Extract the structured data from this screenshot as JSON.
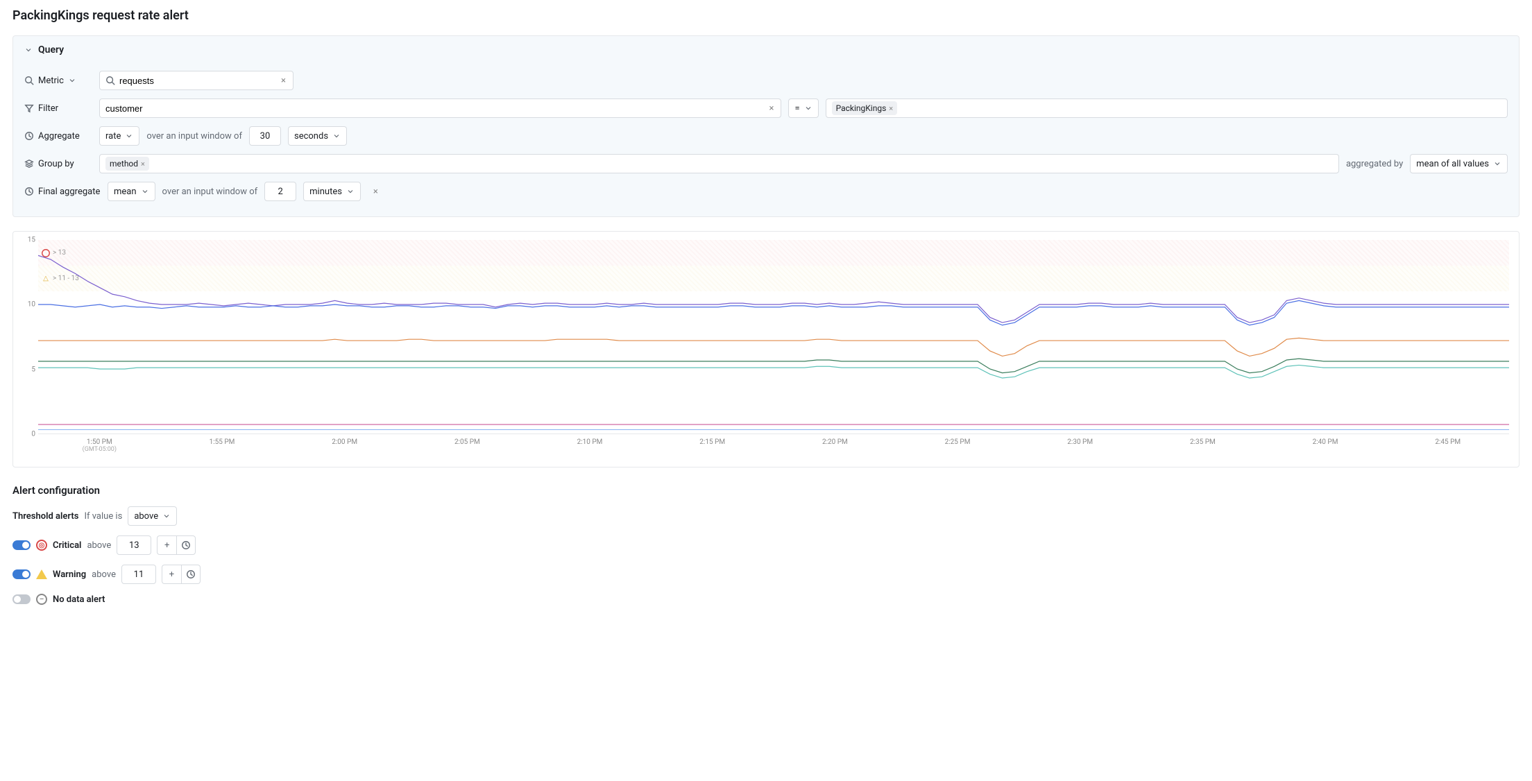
{
  "page_title": "PackingKings request rate alert",
  "query_panel": {
    "header": "Query",
    "rows": {
      "metric": {
        "label": "Metric",
        "value": "requests"
      },
      "filter": {
        "label": "Filter",
        "value": "customer",
        "operator": "=",
        "tag": "PackingKings"
      },
      "aggregate": {
        "label": "Aggregate",
        "fn": "rate",
        "window_text": "over an input window of",
        "window_value": "30",
        "window_unit": "seconds"
      },
      "groupby": {
        "label": "Group by",
        "tag": "method",
        "agg_by_text": "aggregated by",
        "agg_by_value": "mean of all values"
      },
      "final_aggregate": {
        "label": "Final aggregate",
        "fn": "mean",
        "window_text": "over an input window of",
        "window_value": "2",
        "window_unit": "minutes"
      }
    }
  },
  "chart_data": {
    "type": "line",
    "ylim": [
      0,
      15
    ],
    "yticks": [
      0,
      5,
      10,
      15
    ],
    "xlabels": [
      "1:50 PM",
      "1:55 PM",
      "2:00 PM",
      "2:05 PM",
      "2:10 PM",
      "2:15 PM",
      "2:20 PM",
      "2:25 PM",
      "2:30 PM",
      "2:35 PM",
      "2:40 PM",
      "2:45 PM"
    ],
    "tz": "(GMT-05:00)",
    "bands": {
      "critical": {
        "label": "> 13",
        "from": 13,
        "to": 15
      },
      "warning": {
        "label": "> 11 - 13",
        "from": 11,
        "to": 13
      }
    },
    "series": [
      {
        "name": "purple",
        "color": "#7a5fcf",
        "values": [
          13.8,
          13.5,
          12.9,
          12.4,
          11.8,
          11.3,
          10.8,
          10.6,
          10.3,
          10.1,
          10.0,
          10.0,
          10.0,
          10.1,
          10.0,
          9.9,
          10.0,
          10.1,
          10.0,
          9.9,
          10.0,
          10.0,
          10.0,
          10.1,
          10.3,
          10.1,
          10.0,
          10.0,
          10.1,
          10.0,
          10.0,
          10.0,
          10.1,
          10.1,
          10.0,
          10.0,
          10.0,
          9.8,
          10.0,
          10.1,
          10.0,
          10.1,
          10.1,
          10.0,
          10.0,
          10.0,
          10.1,
          10.0,
          10.0,
          10.1,
          10.0,
          10.0,
          10.0,
          10.0,
          10.0,
          10.0,
          10.1,
          10.1,
          10.0,
          10.0,
          10.0,
          10.1,
          10.1,
          10.0,
          10.1,
          10.0,
          10.0,
          10.1,
          10.2,
          10.1,
          10.0,
          10.0,
          10.0,
          10.0,
          10.0,
          10.0,
          10.0,
          9.0,
          8.6,
          8.8,
          9.4,
          10.0,
          10.0,
          10.0,
          10.0,
          10.1,
          10.1,
          10.0,
          10.0,
          10.0,
          10.1,
          10.0,
          10.0,
          10.0,
          10.0,
          10.0,
          10.0,
          9.0,
          8.6,
          8.8,
          9.2,
          10.3,
          10.5,
          10.3,
          10.1,
          10.0,
          10.0,
          10.0,
          10.0,
          10.0,
          10.0,
          10.0,
          10.0,
          10.0,
          10.0,
          10.0,
          10.0,
          10.0,
          10.0,
          10.0
        ]
      },
      {
        "name": "blue",
        "color": "#4a6fe3",
        "values": [
          10.0,
          10.0,
          9.9,
          9.8,
          9.9,
          10.0,
          9.8,
          9.9,
          9.8,
          9.8,
          9.7,
          9.8,
          9.9,
          9.8,
          9.8,
          9.8,
          9.9,
          9.8,
          9.8,
          9.9,
          9.8,
          9.8,
          9.9,
          9.9,
          10.0,
          9.9,
          9.9,
          9.8,
          9.8,
          9.9,
          9.9,
          9.8,
          9.8,
          9.9,
          9.9,
          9.8,
          9.8,
          9.7,
          9.9,
          9.9,
          9.8,
          9.9,
          9.9,
          9.8,
          9.8,
          9.8,
          9.9,
          9.8,
          9.9,
          9.9,
          9.8,
          9.8,
          9.8,
          9.8,
          9.8,
          9.8,
          9.9,
          9.9,
          9.8,
          9.8,
          9.8,
          9.9,
          9.9,
          9.8,
          9.9,
          9.8,
          9.8,
          9.8,
          9.9,
          9.9,
          9.8,
          9.8,
          9.8,
          9.8,
          9.8,
          9.8,
          9.8,
          8.8,
          8.4,
          8.6,
          9.2,
          9.8,
          9.8,
          9.8,
          9.8,
          9.9,
          9.9,
          9.8,
          9.8,
          9.8,
          9.9,
          9.8,
          9.8,
          9.8,
          9.8,
          9.8,
          9.8,
          8.8,
          8.4,
          8.6,
          9.0,
          10.1,
          10.3,
          10.1,
          9.9,
          9.8,
          9.8,
          9.8,
          9.8,
          9.8,
          9.8,
          9.8,
          9.8,
          9.8,
          9.8,
          9.8,
          9.8,
          9.8,
          9.8,
          9.8
        ]
      },
      {
        "name": "orange",
        "color": "#e08b4a",
        "values": [
          7.2,
          7.2,
          7.2,
          7.2,
          7.2,
          7.2,
          7.2,
          7.2,
          7.2,
          7.2,
          7.2,
          7.2,
          7.2,
          7.2,
          7.2,
          7.2,
          7.2,
          7.2,
          7.2,
          7.2,
          7.2,
          7.2,
          7.2,
          7.2,
          7.3,
          7.2,
          7.2,
          7.2,
          7.2,
          7.2,
          7.3,
          7.3,
          7.2,
          7.2,
          7.2,
          7.2,
          7.2,
          7.2,
          7.2,
          7.2,
          7.2,
          7.2,
          7.3,
          7.3,
          7.3,
          7.3,
          7.3,
          7.2,
          7.2,
          7.2,
          7.2,
          7.2,
          7.2,
          7.2,
          7.2,
          7.2,
          7.2,
          7.2,
          7.2,
          7.2,
          7.2,
          7.2,
          7.2,
          7.3,
          7.3,
          7.2,
          7.2,
          7.2,
          7.2,
          7.2,
          7.2,
          7.2,
          7.2,
          7.2,
          7.2,
          7.2,
          7.2,
          6.4,
          6.0,
          6.2,
          6.8,
          7.2,
          7.2,
          7.2,
          7.2,
          7.2,
          7.2,
          7.2,
          7.2,
          7.2,
          7.2,
          7.2,
          7.2,
          7.2,
          7.2,
          7.2,
          7.2,
          6.4,
          6.0,
          6.2,
          6.6,
          7.3,
          7.4,
          7.3,
          7.2,
          7.2,
          7.2,
          7.2,
          7.2,
          7.2,
          7.2,
          7.2,
          7.2,
          7.2,
          7.2,
          7.2,
          7.2,
          7.2,
          7.2,
          7.2
        ]
      },
      {
        "name": "green",
        "color": "#3a7d5c",
        "values": [
          5.6,
          5.6,
          5.6,
          5.6,
          5.6,
          5.6,
          5.6,
          5.6,
          5.6,
          5.6,
          5.6,
          5.6,
          5.6,
          5.6,
          5.6,
          5.6,
          5.6,
          5.6,
          5.6,
          5.6,
          5.6,
          5.6,
          5.6,
          5.6,
          5.6,
          5.6,
          5.6,
          5.6,
          5.6,
          5.6,
          5.6,
          5.6,
          5.6,
          5.6,
          5.6,
          5.6,
          5.6,
          5.6,
          5.6,
          5.6,
          5.6,
          5.6,
          5.6,
          5.6,
          5.6,
          5.6,
          5.6,
          5.6,
          5.6,
          5.6,
          5.6,
          5.6,
          5.6,
          5.6,
          5.6,
          5.6,
          5.6,
          5.6,
          5.6,
          5.6,
          5.6,
          5.6,
          5.6,
          5.7,
          5.7,
          5.6,
          5.6,
          5.6,
          5.6,
          5.6,
          5.6,
          5.6,
          5.6,
          5.6,
          5.6,
          5.6,
          5.6,
          5.0,
          4.7,
          4.8,
          5.2,
          5.6,
          5.6,
          5.6,
          5.6,
          5.6,
          5.6,
          5.6,
          5.6,
          5.6,
          5.6,
          5.6,
          5.6,
          5.6,
          5.6,
          5.6,
          5.6,
          5.0,
          4.7,
          4.8,
          5.2,
          5.7,
          5.8,
          5.7,
          5.6,
          5.6,
          5.6,
          5.6,
          5.6,
          5.6,
          5.6,
          5.6,
          5.6,
          5.6,
          5.6,
          5.6,
          5.6,
          5.6,
          5.6,
          5.6
        ]
      },
      {
        "name": "teal",
        "color": "#5ec2b8",
        "values": [
          5.1,
          5.1,
          5.1,
          5.1,
          5.1,
          5.0,
          5.0,
          5.0,
          5.1,
          5.1,
          5.1,
          5.1,
          5.1,
          5.1,
          5.1,
          5.1,
          5.1,
          5.1,
          5.1,
          5.1,
          5.1,
          5.1,
          5.1,
          5.1,
          5.1,
          5.1,
          5.1,
          5.1,
          5.1,
          5.1,
          5.1,
          5.1,
          5.1,
          5.1,
          5.1,
          5.1,
          5.1,
          5.1,
          5.1,
          5.1,
          5.1,
          5.1,
          5.1,
          5.1,
          5.1,
          5.1,
          5.1,
          5.1,
          5.1,
          5.1,
          5.1,
          5.1,
          5.1,
          5.1,
          5.1,
          5.1,
          5.1,
          5.1,
          5.1,
          5.1,
          5.1,
          5.1,
          5.1,
          5.2,
          5.2,
          5.1,
          5.1,
          5.1,
          5.1,
          5.1,
          5.1,
          5.1,
          5.1,
          5.1,
          5.1,
          5.1,
          5.1,
          4.6,
          4.3,
          4.4,
          4.8,
          5.1,
          5.1,
          5.1,
          5.1,
          5.1,
          5.1,
          5.1,
          5.1,
          5.1,
          5.1,
          5.1,
          5.1,
          5.1,
          5.1,
          5.1,
          5.1,
          4.6,
          4.3,
          4.4,
          4.8,
          5.2,
          5.3,
          5.2,
          5.1,
          5.1,
          5.1,
          5.1,
          5.1,
          5.1,
          5.1,
          5.1,
          5.1,
          5.1,
          5.1,
          5.1,
          5.1,
          5.1,
          5.1,
          5.1
        ]
      },
      {
        "name": "pink",
        "color": "#d16ba5",
        "values": [
          0.7,
          0.7,
          0.7,
          0.7,
          0.7,
          0.7,
          0.7,
          0.7,
          0.7,
          0.7,
          0.7,
          0.7,
          0.7,
          0.7,
          0.7,
          0.7,
          0.7,
          0.7,
          0.7,
          0.7,
          0.7,
          0.7,
          0.7,
          0.7,
          0.7,
          0.7,
          0.7,
          0.7,
          0.7,
          0.7,
          0.7,
          0.7,
          0.7,
          0.7,
          0.7,
          0.7,
          0.7,
          0.7,
          0.7,
          0.7,
          0.7,
          0.7,
          0.7,
          0.7,
          0.7,
          0.7,
          0.7,
          0.7,
          0.7,
          0.7,
          0.7,
          0.7,
          0.7,
          0.7,
          0.7,
          0.7,
          0.7,
          0.7,
          0.7,
          0.7,
          0.7,
          0.7,
          0.7,
          0.7,
          0.7,
          0.7,
          0.7,
          0.7,
          0.7,
          0.7,
          0.7,
          0.7,
          0.7,
          0.7,
          0.7,
          0.7,
          0.7,
          0.7,
          0.7,
          0.7,
          0.7,
          0.7,
          0.7,
          0.7,
          0.7,
          0.7,
          0.7,
          0.7,
          0.7,
          0.7,
          0.7,
          0.7,
          0.7,
          0.7,
          0.7,
          0.7,
          0.7,
          0.7,
          0.7,
          0.7,
          0.7,
          0.7,
          0.7,
          0.7,
          0.7,
          0.7,
          0.7,
          0.7,
          0.7,
          0.7,
          0.7,
          0.7,
          0.7,
          0.7,
          0.7,
          0.7,
          0.7,
          0.7,
          0.7,
          0.7
        ]
      },
      {
        "name": "lightblue",
        "color": "#8fb6f2",
        "values": [
          0.3,
          0.3,
          0.3,
          0.3,
          0.3,
          0.3,
          0.3,
          0.3,
          0.3,
          0.3,
          0.3,
          0.3,
          0.3,
          0.3,
          0.3,
          0.3,
          0.3,
          0.3,
          0.3,
          0.3,
          0.3,
          0.3,
          0.3,
          0.3,
          0.3,
          0.3,
          0.3,
          0.3,
          0.3,
          0.3,
          0.3,
          0.3,
          0.3,
          0.3,
          0.3,
          0.3,
          0.3,
          0.3,
          0.3,
          0.3,
          0.3,
          0.3,
          0.3,
          0.3,
          0.3,
          0.3,
          0.3,
          0.3,
          0.3,
          0.3,
          0.3,
          0.3,
          0.3,
          0.3,
          0.3,
          0.3,
          0.3,
          0.3,
          0.3,
          0.3,
          0.3,
          0.3,
          0.3,
          0.3,
          0.3,
          0.3,
          0.3,
          0.3,
          0.3,
          0.3,
          0.3,
          0.3,
          0.3,
          0.3,
          0.3,
          0.3,
          0.3,
          0.3,
          0.3,
          0.3,
          0.3,
          0.3,
          0.3,
          0.3,
          0.3,
          0.3,
          0.3,
          0.3,
          0.3,
          0.3,
          0.3,
          0.3,
          0.3,
          0.3,
          0.3,
          0.3,
          0.3,
          0.3,
          0.3,
          0.3,
          0.3,
          0.3,
          0.3,
          0.3,
          0.3,
          0.3,
          0.3,
          0.3,
          0.3,
          0.3,
          0.3,
          0.3,
          0.3,
          0.3,
          0.3,
          0.3,
          0.3,
          0.3,
          0.3,
          0.3
        ]
      }
    ]
  },
  "alert_config": {
    "title": "Alert configuration",
    "threshold_label": "Threshold alerts",
    "if_value_is": "If value is",
    "direction": "above",
    "rows": {
      "critical": {
        "label": "Critical",
        "cond": "above",
        "value": "13"
      },
      "warning": {
        "label": "Warning",
        "cond": "above",
        "value": "11"
      },
      "nodata": {
        "label": "No data alert"
      }
    }
  }
}
